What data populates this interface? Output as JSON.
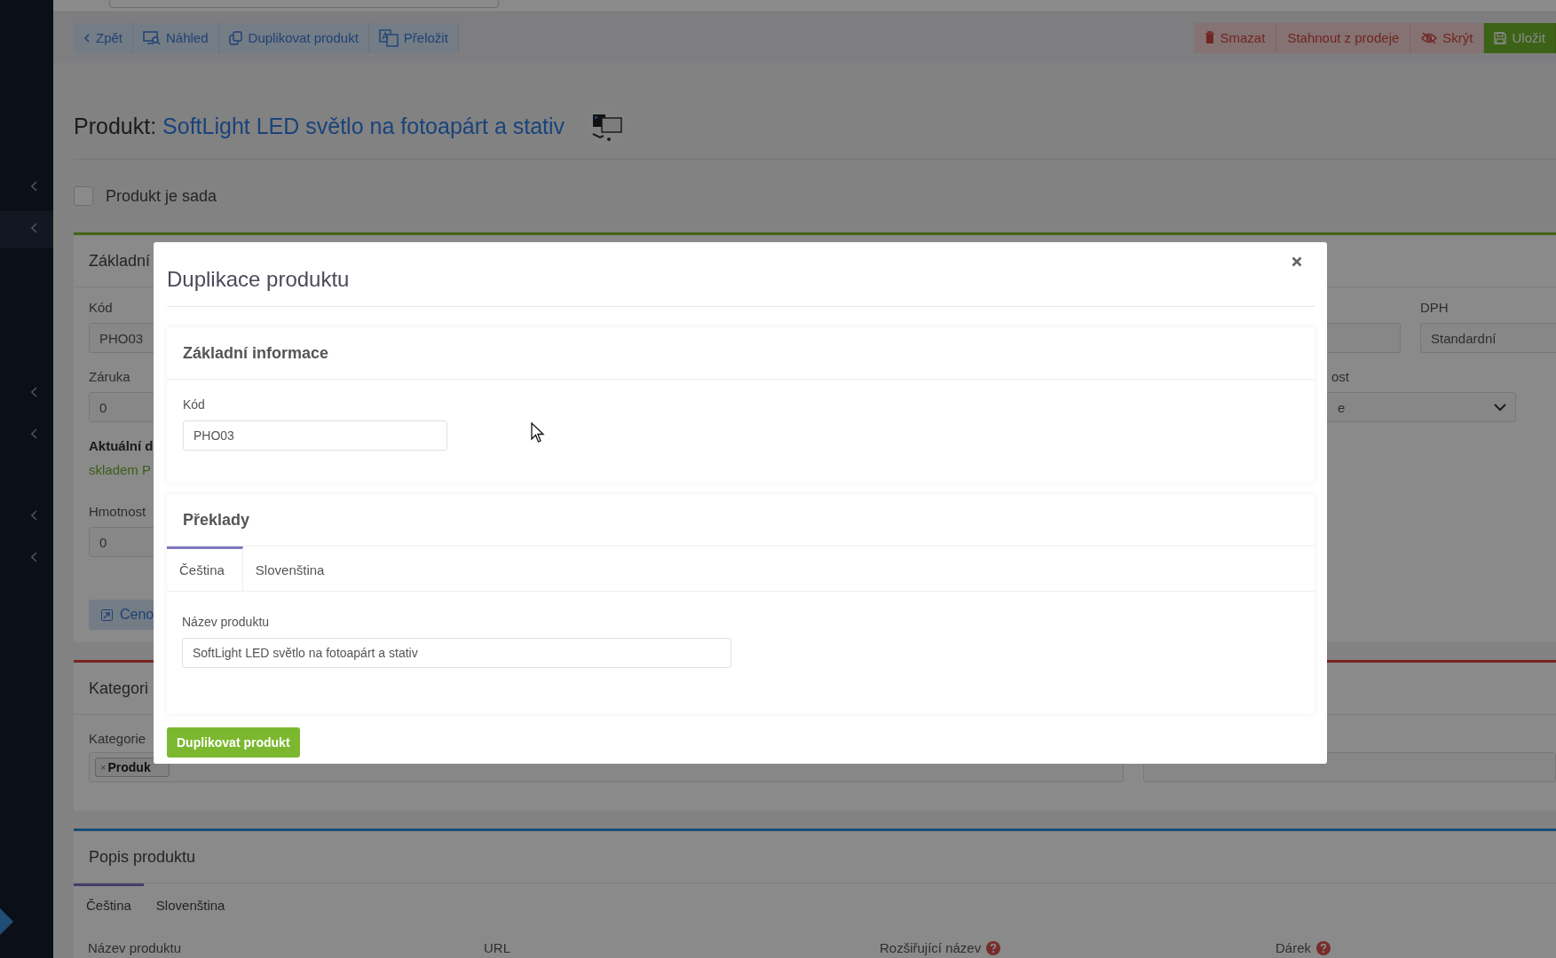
{
  "toolbar": {
    "left": [
      {
        "label": "Zpět",
        "kind": "back"
      },
      {
        "label": "Náhled",
        "kind": "preview"
      },
      {
        "label": "Duplikovat produkt",
        "kind": "duplicate"
      },
      {
        "label": "Přeložit",
        "kind": "translate"
      }
    ],
    "right": [
      {
        "label": "Smazat",
        "kind": "delete"
      },
      {
        "label": "Stahnout z prodeje",
        "kind": "withdraw"
      },
      {
        "label": "Skrýt",
        "kind": "hide"
      },
      {
        "label": "Uložit",
        "kind": "save"
      }
    ]
  },
  "product": {
    "prefix": "Produkt:",
    "name": "SoftLight LED světlo na fotoapárt a stativ"
  },
  "is_set": {
    "label": "Produkt je sada",
    "checked": false
  },
  "basic_info": {
    "title": "Základní",
    "code_label": "Kód",
    "code": "PHO03",
    "warranty_label": "Záruka",
    "warranty": "0",
    "stock_title": "Aktuální d",
    "stock_status": "skladem P",
    "weight_label": "Hmotnost",
    "weight": "0",
    "price_button": "Ceno",
    "vat_label": "DPH",
    "vat": "Standardní",
    "select_label": "ost",
    "select_value": "e"
  },
  "categories": {
    "title": "Kategori",
    "label": "Kategorie",
    "tags": [
      {
        "label": "Produk",
        "remove": "×"
      }
    ]
  },
  "description": {
    "title": "Popis produktu",
    "tabs": [
      {
        "label": "Čeština",
        "selected": true
      },
      {
        "label": "Slovenština",
        "selected": false
      }
    ],
    "columns": [
      {
        "label": "Název produktu",
        "help": false
      },
      {
        "label": "URL",
        "help": false
      },
      {
        "label": "Rozšiřující název",
        "help": true
      },
      {
        "label": "Dárek",
        "help": true
      }
    ]
  },
  "modal": {
    "title": "Duplikace produktu",
    "basic": {
      "title": "Základní informace",
      "code_label": "Kód",
      "code": "PHO03"
    },
    "translations": {
      "title": "Překlady",
      "tabs": [
        {
          "label": "Čeština",
          "selected": true
        },
        {
          "label": "Slovenština",
          "selected": false
        }
      ],
      "name_label": "Název produktu",
      "name": "SoftLight LED světlo na fotoapárt a stativ"
    },
    "submit": "Duplikovat produkt"
  }
}
